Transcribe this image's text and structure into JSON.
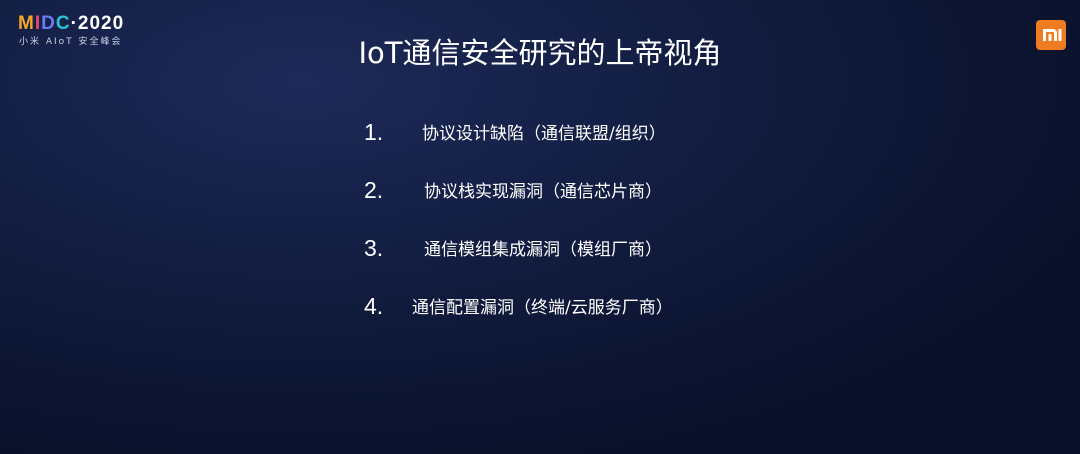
{
  "event_logo": {
    "mark_parts": [
      "M",
      "I",
      "D",
      "C",
      "·2020"
    ],
    "subtitle": "小米 AIoT 安全峰会"
  },
  "brand_logo": {
    "icon": "mi-logo-icon",
    "color": "#f07c22"
  },
  "title": "IoT通信安全研究的上帝视角",
  "items": [
    {
      "number": "1.",
      "text": "协议设计缺陷（通信联盟/组织）"
    },
    {
      "number": "2.",
      "text": "协议栈实现漏洞（通信芯片商）"
    },
    {
      "number": "3.",
      "text": "通信模组集成漏洞（模组厂商）"
    },
    {
      "number": "4.",
      "text": "通信配置漏洞（终端/云服务厂商）"
    }
  ],
  "colors": {
    "background": "#111b3e",
    "text": "#ffffff"
  }
}
